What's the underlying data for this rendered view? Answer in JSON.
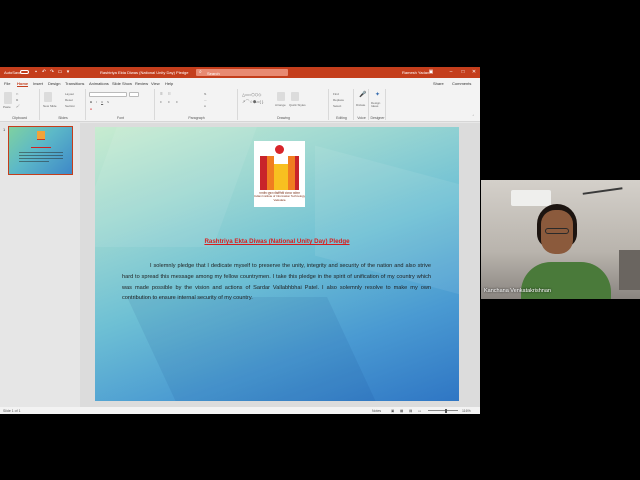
{
  "titlebar": {
    "autosave": "AutoSave",
    "doc_title": "Rashtriya Ekta Diwas (National Unity Day) Pledge",
    "search_placeholder": "Search",
    "user": "Ramesh Yadav"
  },
  "menu": {
    "tabs": [
      "File",
      "Home",
      "Insert",
      "Design",
      "Transitions",
      "Animations",
      "Slide Show",
      "Review",
      "View",
      "Help"
    ],
    "active_tab": "Home",
    "share": "Share",
    "comments": "Comments"
  },
  "ribbon": {
    "groups": [
      "Clipboard",
      "Slides",
      "Font",
      "Paragraph",
      "Drawing",
      "Editing",
      "Voice",
      "Designer"
    ],
    "paste": "Paste",
    "new_slide": "New Slide",
    "layout": "Layout",
    "reset": "Reset",
    "section": "Section",
    "find": "Find",
    "replace": "Replace",
    "select": "Select",
    "dictate": "Dictate",
    "design_ideas": "Design Ideas",
    "arrange": "Arrange",
    "quick_styles": "Quick Styles"
  },
  "thumbnails": [
    {
      "number": "1"
    }
  ],
  "slide": {
    "logo_text_line1": "भारतीय सूचना प्रौद्योगिकी संस्थान वडोदरा",
    "logo_text_line2": "Indian Institute of Information Technology Vadodara",
    "title": "Rashtriya Ekta Diwas (National Unity Day) Pledge",
    "body": "I solemnly pledge that I dedicate myself to preserve the unity, integrity and security of the nation and also strive hard to spread this message among my fellow countrymen. I take this pledge in the spirit of unification of my country which was made possible by the vision and actions of Sardar Vallabhbhai Patel. I also solemnly resolve to make my own contribution to ensure internal security of my country."
  },
  "statusbar": {
    "slide_count": "Slide 1 of 1",
    "notes": "Notes",
    "zoom": "116%"
  },
  "webcam": {
    "participant_name": "Kanchana Venkatakrishnan"
  },
  "colors": {
    "ppt_accent": "#c43e1c",
    "pledge_title": "#d81e1e"
  }
}
